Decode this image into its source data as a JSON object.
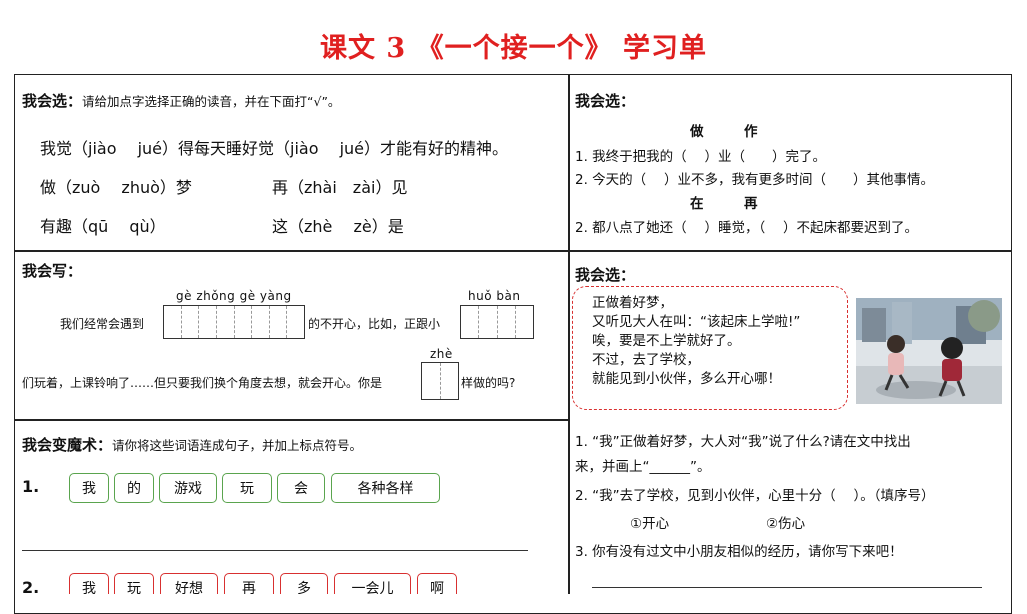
{
  "title": "课文 3 《一个接一个》 学习单",
  "section1": {
    "heading": "我会选：",
    "instruction": "请给加点字选择正确的读音，并在下面打“√”。",
    "line1": "我觉（jiào　 jué）得每天睡好觉（jiào　 jué）才能有好的精神。",
    "line2a": "做（zuò　 zhuò）梦",
    "line2b": "再（zhài　zài）见",
    "line3a": "有趣（qū　 qù）",
    "line3b": "这（zhè　 zè）是"
  },
  "section2": {
    "heading": "我会选：",
    "pair1": "做　　　作",
    "q1": "1. 我终于把我的（　 ）业（　　）完了。",
    "q2": "2. 今天的（　 ）业不多，我有更多时间（　　）其他事情。",
    "pair2": "在　　　再",
    "q3": "2. 都八点了她还（　 ）睡觉，（　 ）不起床都要迟到了。"
  },
  "section3": {
    "heading": "我会写：",
    "pinyin1": "gè zhǒng gè yàng",
    "pinyin2": "huǒ bàn",
    "pinyin3": "zhè",
    "text1": "我们经常会遇到",
    "text2": "的不开心，比如，正跟小",
    "text3": "们玩着，上课铃响了……但只要我们换个角度去想，就会开心。你是",
    "text4": "样做的吗?"
  },
  "section4": {
    "heading": "我会选：",
    "poem": [
      "正做着好梦，",
      "又听见大人在叫：“该起床上学啦!”",
      "唉，要是不上学就好了。",
      "不过，去了学校，",
      "就能见到小伙伴，多么开心哪！"
    ],
    "q1a": "1. “我”正做着好梦，大人对“我”说了什么?请在文中找出",
    "q1b": "来，并画上“______”。",
    "q2": "2. “我”去了学校，见到小伙伴，心里十分（　 ）。（填序号）",
    "opt1": "①开心",
    "opt2": "②伤心",
    "q3": "3. 你有没有过文中小朋友相似的经历，请你写下来吧！"
  },
  "section5": {
    "heading": "我会变魔术：",
    "instruction": "请你将这些词语连成句子，并加上标点符号。",
    "num1": "1.",
    "words1": [
      "我",
      "的",
      "游戏",
      "玩",
      "会",
      "各种各样"
    ],
    "num2": "2.",
    "words2": [
      "我",
      "玩",
      "好想",
      "再",
      "多",
      "一会儿",
      "啊"
    ]
  },
  "colors": {
    "title": "#e02020",
    "chip_green": "#5aa44e",
    "chip_red": "#d83030"
  }
}
